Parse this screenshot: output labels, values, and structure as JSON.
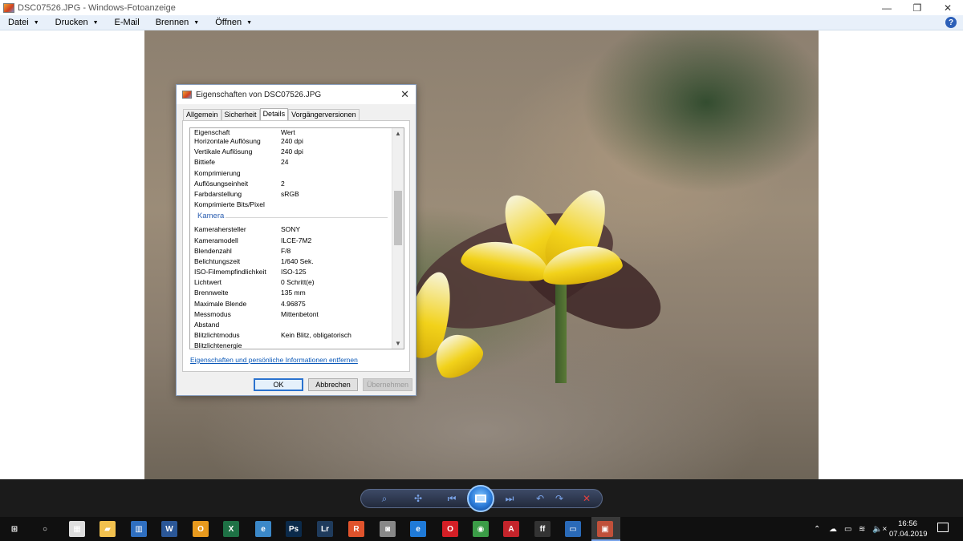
{
  "window": {
    "title": "DSC07526.JPG - Windows-Fotoanzeige",
    "minimize_glyph": "—",
    "restore_glyph": "❐",
    "close_glyph": "✕"
  },
  "menu": {
    "items": [
      {
        "label": "Datei",
        "has_dropdown": true
      },
      {
        "label": "Drucken",
        "has_dropdown": true
      },
      {
        "label": "E-Mail",
        "has_dropdown": false
      },
      {
        "label": "Brennen",
        "has_dropdown": true
      },
      {
        "label": "Öffnen",
        "has_dropdown": true
      }
    ],
    "help_glyph": "?"
  },
  "dialog": {
    "title": "Eigenschaften von DSC07526.JPG",
    "close_glyph": "✕",
    "tabs": [
      "Allgemein",
      "Sicherheit",
      "Details",
      "Vorgängerversionen"
    ],
    "active_tab": "Details",
    "header": {
      "property": "Eigenschaft",
      "value": "Wert"
    },
    "rows_image": [
      {
        "k": "Horizontale Auflösung",
        "v": "240 dpi"
      },
      {
        "k": "Vertikale Auflösung",
        "v": "240 dpi"
      },
      {
        "k": "Bittiefe",
        "v": "24"
      },
      {
        "k": "Komprimierung",
        "v": ""
      },
      {
        "k": "Auflösungseinheit",
        "v": "2"
      },
      {
        "k": "Farbdarstellung",
        "v": "sRGB"
      },
      {
        "k": "Komprimierte Bits/Pixel",
        "v": ""
      }
    ],
    "section_camera": "Kamera",
    "rows_camera": [
      {
        "k": "Kamerahersteller",
        "v": "SONY"
      },
      {
        "k": "Kameramodell",
        "v": "ILCE-7M2"
      },
      {
        "k": "Blendenzahl",
        "v": "F/8"
      },
      {
        "k": "Belichtungszeit",
        "v": "1/640 Sek."
      },
      {
        "k": "ISO-Filmempfindlichkeit",
        "v": "ISO-125"
      },
      {
        "k": "Lichtwert",
        "v": "0 Schritt(e)"
      },
      {
        "k": "Brennweite",
        "v": "135 mm"
      },
      {
        "k": "Maximale Blende",
        "v": "4.96875"
      },
      {
        "k": "Messmodus",
        "v": "Mittenbetont"
      },
      {
        "k": "Abstand",
        "v": ""
      },
      {
        "k": "Blitzlichtmodus",
        "v": "Kein Blitz, obligatorisch"
      },
      {
        "k": "Blitzlichtenergie",
        "v": ""
      }
    ],
    "scroll_position": 0.3,
    "remove_link": "Eigenschaften und persönliche Informationen entfernen",
    "buttons": {
      "ok": "OK",
      "cancel": "Abbrechen",
      "apply": "Übernehmen"
    }
  },
  "viewer_toolbar": {
    "buttons": [
      "zoom-icon",
      "actual-size-icon",
      "previous-icon",
      "slideshow-icon",
      "next-icon",
      "rotate-left-icon",
      "rotate-right-icon",
      "delete-icon"
    ]
  },
  "taskbar": {
    "apps": [
      {
        "name": "start-icon",
        "glyph": "⊞"
      },
      {
        "name": "search-circle-icon",
        "glyph": "○"
      },
      {
        "name": "calculator-icon",
        "glyph": "▦"
      },
      {
        "name": "file-explorer-icon",
        "glyph": "▰"
      },
      {
        "name": "winrar-icon",
        "glyph": "▥"
      },
      {
        "name": "word-icon",
        "glyph": "W"
      },
      {
        "name": "outlook-icon",
        "glyph": "O"
      },
      {
        "name": "excel-icon",
        "glyph": "X"
      },
      {
        "name": "edge-legacy-icon",
        "glyph": "e"
      },
      {
        "name": "photoshop-icon",
        "glyph": "Ps"
      },
      {
        "name": "lightroom-icon",
        "glyph": "Lr"
      },
      {
        "name": "app-r-icon",
        "glyph": "R"
      },
      {
        "name": "camera-icon",
        "glyph": "◙"
      },
      {
        "name": "edge-icon",
        "glyph": "e"
      },
      {
        "name": "opera-icon",
        "glyph": "O"
      },
      {
        "name": "chrome-icon",
        "glyph": "◉"
      },
      {
        "name": "acrobat-icon",
        "glyph": "A"
      },
      {
        "name": "fontforge-icon",
        "glyph": "ff"
      },
      {
        "name": "photos-icon",
        "glyph": "▭"
      },
      {
        "name": "photo-viewer-icon",
        "glyph": "▣"
      }
    ],
    "tray": {
      "up_arrow": "⌃",
      "cloud": "☁",
      "battery": "▭",
      "wifi": "≋",
      "volume": "🔈×"
    },
    "clock_time": "16:56",
    "clock_date": "07.04.2019"
  },
  "colors": {
    "accent": "#2b73cf",
    "link": "#0a58b8",
    "menubar": "#e8f0fa",
    "taskbar": "#101010"
  }
}
